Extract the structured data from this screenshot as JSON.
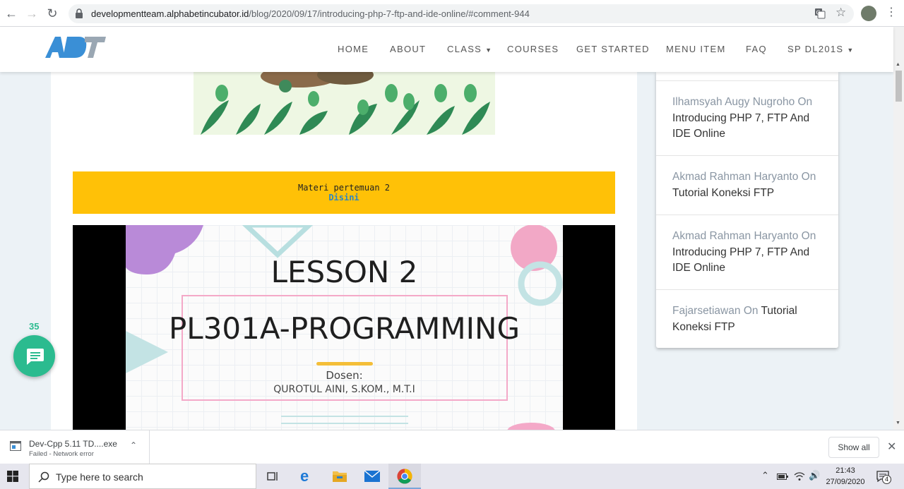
{
  "browser": {
    "url_host": "developmentteam.alphabetincubator.id",
    "url_path": "/blog/2020/09/17/introducing-php-7-ftp-and-ide-online/#comment-944"
  },
  "site": {
    "logo_text": "ADT",
    "menu": [
      {
        "label": "HOME"
      },
      {
        "label": "ABOUT"
      },
      {
        "label": "CLASS",
        "dropdown": true
      },
      {
        "label": "COURSES"
      },
      {
        "label": "GET STARTED"
      },
      {
        "label": "MENU ITEM"
      },
      {
        "label": "FAQ"
      },
      {
        "label": "SP DL201S",
        "dropdown": true
      }
    ]
  },
  "notice": {
    "text": "Materi pertemuan 2",
    "link": "Disini",
    "color": "#ffc107"
  },
  "slide": {
    "title": "LESSON 2",
    "course": "PL301A-PROGRAMMING",
    "dosen_label": "Dosen:",
    "dosen_name": "QUROTUL AINI, S.KOM., M.T.I"
  },
  "sidebar": {
    "comments": [
      {
        "author": "Ilhamsyah Augy Nugroho",
        "on": "On",
        "post": "Introducing PHP 7, FTP And IDE Online"
      },
      {
        "author": "Akmad Rahman Haryanto",
        "on": "On",
        "post": "Tutorial Koneksi FTP"
      },
      {
        "author": "Akmad Rahman Haryanto",
        "on": "On",
        "post": "Introducing PHP 7, FTP And IDE Online"
      },
      {
        "author": "Fajarsetiawan",
        "on": "On",
        "post": "Tutorial Koneksi FTP"
      }
    ]
  },
  "chat": {
    "count": "35",
    "color": "#2bbb8f"
  },
  "download": {
    "filename": "Dev-Cpp 5.11 TD....exe",
    "status": "Failed - Network error",
    "show_all": "Show all"
  },
  "taskbar": {
    "search_placeholder": "Type here to search",
    "time": "21:43",
    "date": "27/09/2020",
    "notifications": "4"
  }
}
